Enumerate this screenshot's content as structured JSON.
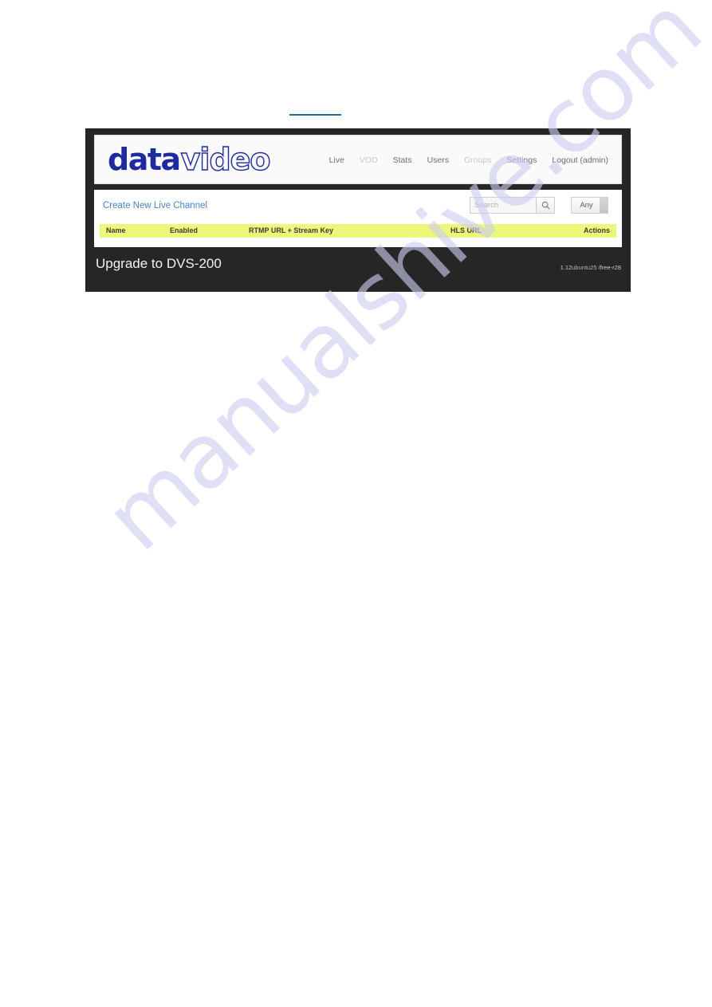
{
  "page": {
    "background": "#ffffff",
    "watermark_text": "manualshive.com",
    "watermark_color": "#ccccf0",
    "rule_color": "#1e6f91"
  },
  "screenshot": {
    "frame_color": "#262626",
    "header": {
      "logo": {
        "part1": "data",
        "part2": "video",
        "color": "#1f2a9e"
      },
      "nav": [
        {
          "label": "Live",
          "name": "nav-live",
          "dim": false
        },
        {
          "label": "VOD",
          "name": "nav-vod",
          "dim": true
        },
        {
          "label": "Stats",
          "name": "nav-stats",
          "dim": false
        },
        {
          "label": "Users",
          "name": "nav-users",
          "dim": false
        },
        {
          "label": "Groups",
          "name": "nav-groups",
          "dim": true
        },
        {
          "label": "Settings",
          "name": "nav-settings",
          "dim": false
        },
        {
          "label": "Logout (admin)",
          "name": "nav-logout",
          "dim": false
        }
      ]
    },
    "toolbar": {
      "create_link": "Create New Live Channel",
      "search_placeholder": "Search",
      "search_value": "",
      "search_icon": "search-icon",
      "filter_value": "Any"
    },
    "table": {
      "header_bg": "#edf77a",
      "columns": [
        "Name",
        "Enabled",
        "RTMP URL + Stream Key",
        "HLS URL",
        "Actions"
      ],
      "rows": []
    },
    "footer": {
      "upgrade_title": "Upgrade to DVS-200",
      "version_prefix": "1.12",
      "version_mid": "ubuntu25",
      "version_suffix": " /free-r28"
    }
  }
}
